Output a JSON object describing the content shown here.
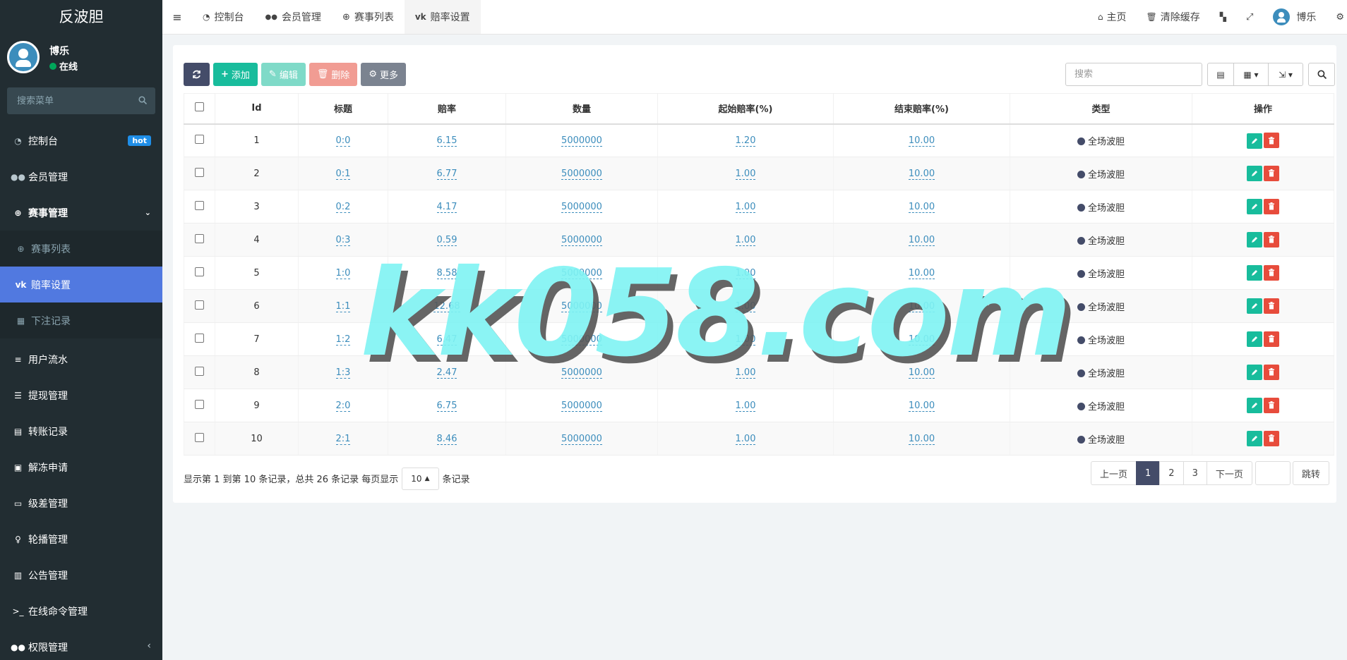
{
  "app": {
    "title": "反波胆"
  },
  "user": {
    "name": "博乐",
    "status": "在线"
  },
  "sidebar": {
    "search_placeholder": "搜索菜单",
    "items": [
      {
        "label": "控制台",
        "icon": "dashboard-icon",
        "badge": "hot"
      },
      {
        "label": "会员管理",
        "icon": "users-icon"
      },
      {
        "label": "赛事管理",
        "icon": "globe-icon"
      },
      {
        "label": "赛事列表",
        "icon": "globe-icon"
      },
      {
        "label": "赔率设置",
        "icon": "vk-icon"
      },
      {
        "label": "下注记录",
        "icon": "calendar-icon"
      },
      {
        "label": "用户流水",
        "icon": "list-icon"
      },
      {
        "label": "提现管理",
        "icon": "list-alt-icon"
      },
      {
        "label": "转账记录",
        "icon": "map-icon"
      },
      {
        "label": "解冻申请",
        "icon": "picture-icon"
      },
      {
        "label": "级差管理",
        "icon": "window-icon"
      },
      {
        "label": "轮播管理",
        "icon": "venus-icon"
      },
      {
        "label": "公告管理",
        "icon": "newspaper-icon"
      },
      {
        "label": "在线命令管理",
        "icon": "terminal-icon"
      },
      {
        "label": "权限管理",
        "icon": "group-icon"
      }
    ]
  },
  "topnav": {
    "tabs": [
      {
        "label": "控制台",
        "icon": "dashboard-icon"
      },
      {
        "label": "会员管理",
        "icon": "users-icon"
      },
      {
        "label": "赛事列表",
        "icon": "globe-icon"
      },
      {
        "label": "赔率设置",
        "icon": "vk-icon"
      }
    ],
    "home": "主页",
    "clear_cache": "清除缓存",
    "user": "博乐"
  },
  "toolbar": {
    "add": "添加",
    "edit": "编辑",
    "delete": "删除",
    "more": "更多",
    "search_placeholder": "搜索"
  },
  "table": {
    "headers": [
      "Id",
      "标题",
      "赔率",
      "数量",
      "起始赔率(%)",
      "结束赔率(%)",
      "类型",
      "操作"
    ],
    "rows": [
      {
        "id": "1",
        "title": "0:0",
        "odds": "6.15",
        "qty": "5000000",
        "start": "1.20",
        "end": "10.00",
        "type": "全场波胆"
      },
      {
        "id": "2",
        "title": "0:1",
        "odds": "6.77",
        "qty": "5000000",
        "start": "1.00",
        "end": "10.00",
        "type": "全场波胆"
      },
      {
        "id": "3",
        "title": "0:2",
        "odds": "4.17",
        "qty": "5000000",
        "start": "1.00",
        "end": "10.00",
        "type": "全场波胆"
      },
      {
        "id": "4",
        "title": "0:3",
        "odds": "0.59",
        "qty": "5000000",
        "start": "1.00",
        "end": "10.00",
        "type": "全场波胆"
      },
      {
        "id": "5",
        "title": "1:0",
        "odds": "8.58",
        "qty": "5000000",
        "start": "1.00",
        "end": "10.00",
        "type": "全场波胆"
      },
      {
        "id": "6",
        "title": "1:1",
        "odds": "12.68",
        "qty": "5000000",
        "start": "1.00",
        "end": "10.00",
        "type": "全场波胆"
      },
      {
        "id": "7",
        "title": "1:2",
        "odds": "6.47",
        "qty": "5000000",
        "start": "1.00",
        "end": "10.00",
        "type": "全场波胆"
      },
      {
        "id": "8",
        "title": "1:3",
        "odds": "2.47",
        "qty": "5000000",
        "start": "1.00",
        "end": "10.00",
        "type": "全场波胆"
      },
      {
        "id": "9",
        "title": "2:0",
        "odds": "6.75",
        "qty": "5000000",
        "start": "1.00",
        "end": "10.00",
        "type": "全场波胆"
      },
      {
        "id": "10",
        "title": "2:1",
        "odds": "8.46",
        "qty": "5000000",
        "start": "1.00",
        "end": "10.00",
        "type": "全场波胆"
      }
    ]
  },
  "pagination": {
    "info_prefix": "显示第 1 到第 10 条记录，总共 26 条记录 每页显示",
    "page_size": "10",
    "info_suffix": "条记录",
    "prev": "上一页",
    "pages": [
      "1",
      "2",
      "3"
    ],
    "current": "1",
    "next": "下一页",
    "jump": "跳转"
  },
  "watermark": "kk058.com",
  "colors": {
    "sidebar_bg": "#222d32",
    "active": "#5179e0",
    "primary": "#444c69",
    "success": "#18bc9c",
    "danger": "#e74c3c"
  }
}
